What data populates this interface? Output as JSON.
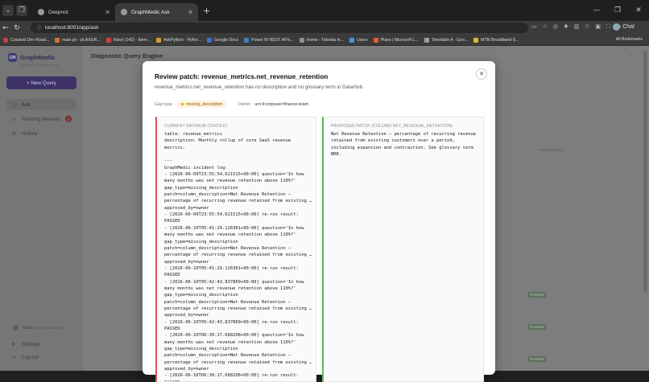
{
  "browser": {
    "tabs": [
      {
        "title": "Deepnot",
        "active": false
      },
      {
        "title": "GraphMedic Ask",
        "active": true
      }
    ],
    "url": "localhost:8001/app/ask",
    "chat_label": "Chat",
    "bookmarks": [
      "Cracked Dev Road...",
      "main.py - pLAXGR...",
      "Inbox (142) - lbem...",
      "AskPython - Pytho...",
      "Google Docs",
      "Power BI REST APIs...",
      "Home - Tekedia In...",
      "Users",
      "Plans | Microsoft L...",
      "Timetable A - Goo...",
      "MTN Broadband S..."
    ],
    "bookmarks_folder": "All Bookmarks"
  },
  "sidebar": {
    "brand": "GraphMedic",
    "brand_sub": "AI-powered diagnostic hub",
    "new_query": "+ New Query",
    "items": [
      {
        "label": "Ask",
        "icon": "chat-icon",
        "active": true
      },
      {
        "label": "Pending Reviews",
        "icon": "clock-icon",
        "badge": "1"
      },
      {
        "label": "History",
        "icon": "history-icon"
      }
    ],
    "user": {
      "name": "Seun",
      "email": "seun@gmail.com"
    },
    "settings": "Settings",
    "logout": "Log out"
  },
  "main": {
    "title": "Diagnostic Query Engine",
    "bg_hint": "last drafted a",
    "bg_badges": [
      "PASSED",
      "PASSED",
      "PASSED"
    ]
  },
  "modal": {
    "title": "Review patch: revenue_metrics.net_revenue_retention",
    "subtitle": "revenue_metrics.net_revenue_retention has no description and no glossary term in DataHub.",
    "gap_type_label": "Gap type",
    "gap_type_value": "missing_description",
    "owner_label": "Owner",
    "owner_value": "urn:li:corpuser:finance-team",
    "current_label": "CURRENT DATAHUB CONTEXT",
    "current_text": "table: revenue_metrics\ndescription: Monthly rollup of core SaaS revenue metrics.\n\n---\nGraphMedic incident log:\n- [2026-06-09T23:55:54.621515+00:00] question='In how many months was net revenue retention above 110%?' gap_type=missing_description patch=column_description=Net Revenue Retention — percentage of recurring revenue retained from existing … approved_by=owner\n- [2026-06-09T23:55:54.621515+00:00] re-run result: PASSED\n- [2026-06-10T05:41:29.126301+00:00] question='In how many months was net revenue retention above 110%?' gap_type=missing_description patch=column_description=Net Revenue Retention — percentage of recurring revenue retained from existing … approved_by=owner\n- [2026-06-10T05:41:29.126301+00:00] re-run result: PASSED\n- [2026-06-10T05:42:43.837809+00:00] question='In how many months was net revenue retention above 110%?' gap_type=missing_description patch=column_description=Net Revenue Retention — percentage of recurring revenue retained from existing … approved_by=owner\n- [2026-06-10T05:42:43.837809+00:00] re-run result: PASSED\n- [2026-06-10T06:30:17.688208+00:00] question='In how many months was net revenue retention above 110%?' gap_type=missing_description patch=column_description=Net Revenue Retention — percentage of recurring revenue retained from existing … approved_by=owner\n- [2026-06-10T06:30:17.688208+00:00] re-run result: PASSED\ncolumn: net_revenue_retention\ncolumn description: (none)",
    "proposed_label": "PROPOSED PATCH (COLUMN NET_REVENUE_RETENTION)",
    "proposed_text": "Net Revenue Retention — percentage of recurring revenue retained from existing customers over a period, including expansion and contraction. See glossary term NRR."
  }
}
